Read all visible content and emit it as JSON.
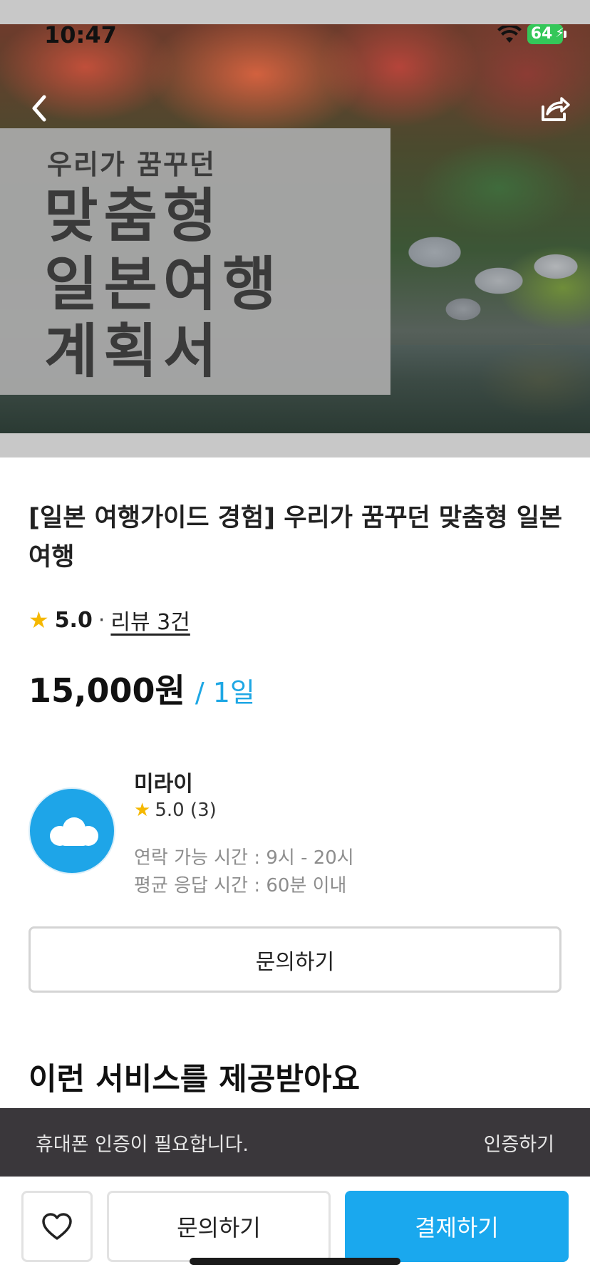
{
  "status_bar": {
    "time": "10:47",
    "battery": "64"
  },
  "hero": {
    "subtitle": "우리가 꿈꾸던",
    "line1": "맞춤형",
    "line2": "일본여행",
    "line3": "계획서",
    "back_icon": "chevron-left-icon",
    "share_icon": "share-icon"
  },
  "product": {
    "title": "[일본 여행가이드 경험] 우리가 꿈꾸던 맞춤형 일본여행",
    "rating": "5.0",
    "rating_separator": "·",
    "reviews_label": "리뷰 3건",
    "price": "15,000원",
    "per_unit": "/ 1일"
  },
  "seller": {
    "name": "미라이",
    "rating": "5.0 (3)",
    "contact_hours": "연락 가능 시간 : 9시 - 20시",
    "avg_response": "평균 응답 시간 : 60분 이내",
    "inquire_label": "문의하기"
  },
  "section": {
    "title": "이런 서비스를 제공받아요"
  },
  "verify_bar": {
    "message": "휴대폰 인증이 필요합니다.",
    "action": "인증하기"
  },
  "bottom_bar": {
    "inquire_label": "문의하기",
    "pay_label": "결제하기",
    "like_icon": "heart-icon"
  },
  "colors": {
    "accent": "#1aa8ee",
    "star": "#f5b800",
    "verify_bar_bg": "#3a373b",
    "battery": "#34c759"
  }
}
